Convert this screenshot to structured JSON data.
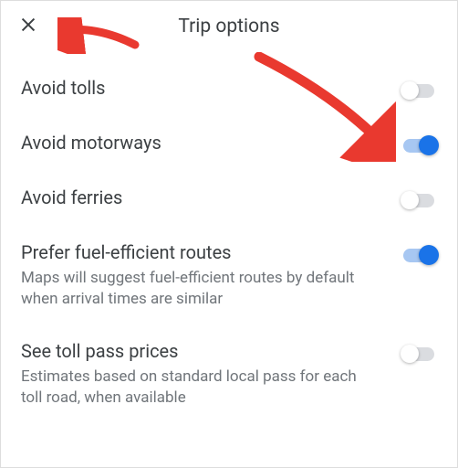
{
  "header": {
    "title": "Trip options"
  },
  "options": [
    {
      "label": "Avoid tolls",
      "desc": "",
      "on": false
    },
    {
      "label": "Avoid motorways",
      "desc": "",
      "on": true
    },
    {
      "label": "Avoid ferries",
      "desc": "",
      "on": false
    },
    {
      "label": "Prefer fuel-efficient routes",
      "desc": "Maps will suggest fuel-efficient routes by default when arrival times are similar",
      "on": true
    },
    {
      "label": "See toll pass prices",
      "desc": "Estimates based on standard local pass for each toll road, when available",
      "on": false
    }
  ]
}
